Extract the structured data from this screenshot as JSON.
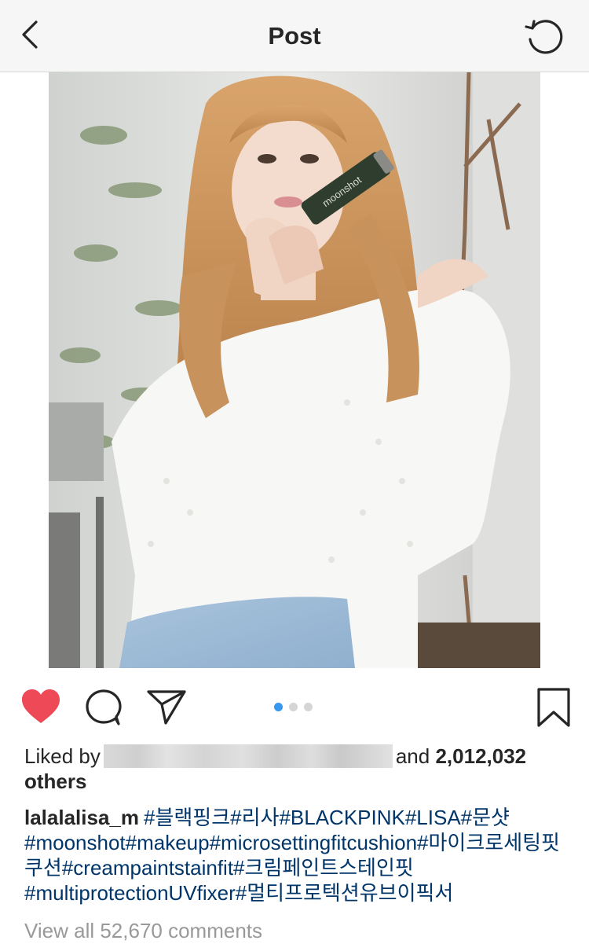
{
  "header": {
    "title": "Post"
  },
  "icons": {
    "back": "chevron-left-icon",
    "refresh": "refresh-icon",
    "like": "heart-icon",
    "comment": "comment-bubble-icon",
    "share": "paper-plane-icon",
    "save": "bookmark-icon"
  },
  "carousel": {
    "total": 3,
    "current": 1
  },
  "likes": {
    "prefix": "Liked by",
    "and": "and",
    "count": "2,012,032",
    "suffix": "others"
  },
  "caption": {
    "username": "lalalalisa_m",
    "text": "#블랙핑크#리사#BLACKPINK#LISA#문샷#moonshot#makeup#microsettingfitcushion#마이크로세팅핏쿠션#creampaintstainfit#크림페인트스테인핏#multiprotectionUVfixer#멀티프로텍션유브이픽서"
  },
  "comments": {
    "view_all": "View all 52,670 comments"
  },
  "photo": {
    "product_label": "moonshot"
  },
  "colors": {
    "like": "#ed4956",
    "link": "#003569",
    "dot_active": "#3897f0",
    "muted": "#999999"
  }
}
